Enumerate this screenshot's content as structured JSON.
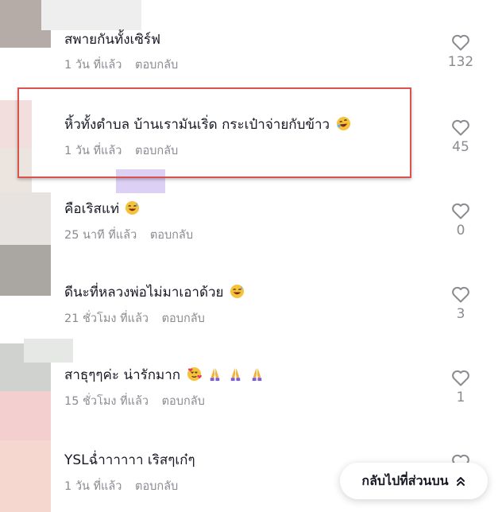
{
  "comments": [
    {
      "text": "สพายกันทั้งเซิร์ฟ",
      "time": "1 วัน ที่แล้ว",
      "reply": "ตอบกลับ",
      "likes": "132"
    },
    {
      "text": "หิ้วทั้งตำบล บ้านเรามันเริ่ด กระเป๋าจ่ายกับข้าว",
      "time": "1 วัน ที่แล้ว",
      "reply": "ตอบกลับ",
      "likes": "45",
      "emoji": [
        "rolling-laugh-emoji"
      ]
    },
    {
      "text": "คือเริสแท่",
      "time": "25 นาที ที่แล้ว",
      "reply": "ตอบกลับ",
      "likes": "0",
      "emoji": [
        "sweat-smile-emoji"
      ]
    },
    {
      "text": "ดีนะที่หลวงพ่อไม่มาเอาด้วย",
      "time": "21 ชั่วโมง ที่แล้ว",
      "reply": "ตอบกลับ",
      "likes": "3",
      "emoji": [
        "sweat-smile-emoji"
      ]
    },
    {
      "text": "สาธุๆๆค่ะ น่ารักมาก",
      "time": "15 ชั่วโมง ที่แล้ว",
      "reply": "ตอบกลับ",
      "likes": "1",
      "emoji": [
        "hearts-face-emoji",
        "pray-emoji",
        "pray-emoji",
        "pray-emoji"
      ]
    },
    {
      "text": "YSLฉ่ำาาาาา เริสๆเก๋ๆ",
      "time": "1 วัน ที่แล้ว",
      "reply": "ตอบกลับ"
    }
  ],
  "back_to_top": "กลับไปที่ส่วนบน",
  "colors": {
    "highlight": "#d9534f",
    "muted": "#8a8b91",
    "text": "#161823"
  }
}
